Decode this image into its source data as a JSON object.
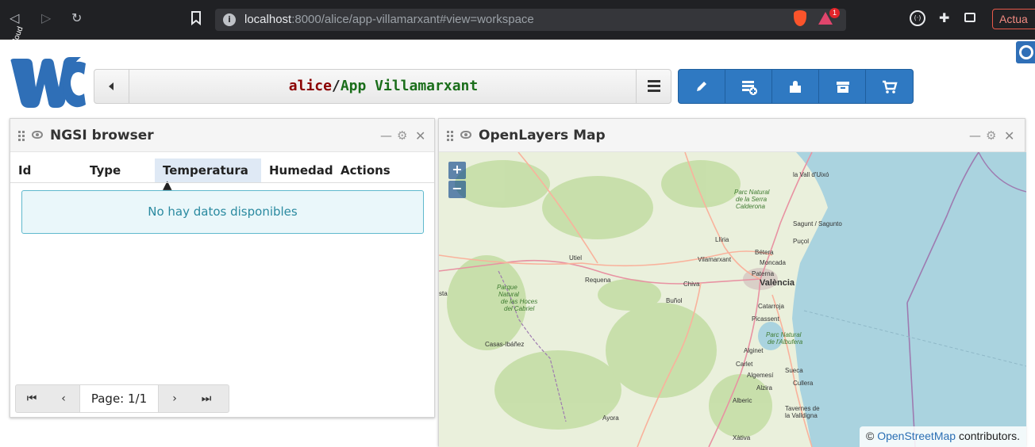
{
  "browser": {
    "url_host": "localhost",
    "url_path": ":8000/alice/app-villamarxant#view=workspace",
    "rewards_count": "1",
    "update_label": "Actua"
  },
  "header": {
    "logo_text": "Wirecloud",
    "owner": "alice",
    "separator": "/",
    "workspace_name": "App Villamarxant"
  },
  "toolbar": {
    "buttons": [
      "edit",
      "add-widget",
      "add-component",
      "archive",
      "marketplace"
    ]
  },
  "ngsi_widget": {
    "title": "NGSI browser",
    "columns": [
      "Id",
      "Type",
      "Temperatura ▲",
      "Humedad",
      "Actions"
    ],
    "empty_message": "No hay datos disponibles",
    "page_label": "Page: 1/1",
    "pager": {
      "first": "⏮",
      "prev": "‹",
      "next": "›",
      "last": "⏭"
    }
  },
  "map_widget": {
    "title": "OpenLayers Map",
    "zoom_in": "+",
    "zoom_out": "−",
    "attribution_prefix": "©",
    "attribution_link": "OpenStreetMap",
    "attribution_suffix": "contributors.",
    "labels": {
      "la_vall": "la Vall d'Uixó",
      "parc_serra_1": "Parc Natural",
      "parc_serra_2": "de la Serra",
      "parc_serra_3": "Calderona",
      "sagunt": "Sagunt / Sagunto",
      "puzol": "Puçol",
      "lliria": "Llíria",
      "betera": "Bétera",
      "villamarxant": "Vilamarxant",
      "moncada": "Moncada",
      "paterna": "Paterna",
      "valencia": "València",
      "utiel": "Utiel",
      "requena": "Requena",
      "chiva": "Chiva",
      "bunol": "Buñol",
      "catarroja": "Catarroja",
      "picassent": "Picassent",
      "parc_albufera_1": "Parc Natural",
      "parc_albufera_2": "de l'Albufera",
      "parque_hoces_1": "Parque",
      "parque_hoces_2": "Natural",
      "parque_hoces_3": "de las Hoces",
      "parque_hoces_4": "del Cabriel",
      "sta": "sta",
      "casas_ibanez": "Casas-Ibáñez",
      "alginet": "Alginet",
      "carlet": "Carlet",
      "sueca": "Sueca",
      "algemesi": "Algemesí",
      "cullera": "Cullera",
      "alzira": "Alzira",
      "alberic": "Alberic",
      "tavernes_1": "Tavernes de",
      "tavernes_2": "la Valldigna",
      "ayora": "Ayora",
      "xativa": "Xàtiva"
    }
  },
  "colors": {
    "owner": "#8b0000",
    "workspace": "#1b6e1b",
    "toolbar": "#2f79c2",
    "sea": "#aad3df",
    "land": "#eaf0dc"
  }
}
